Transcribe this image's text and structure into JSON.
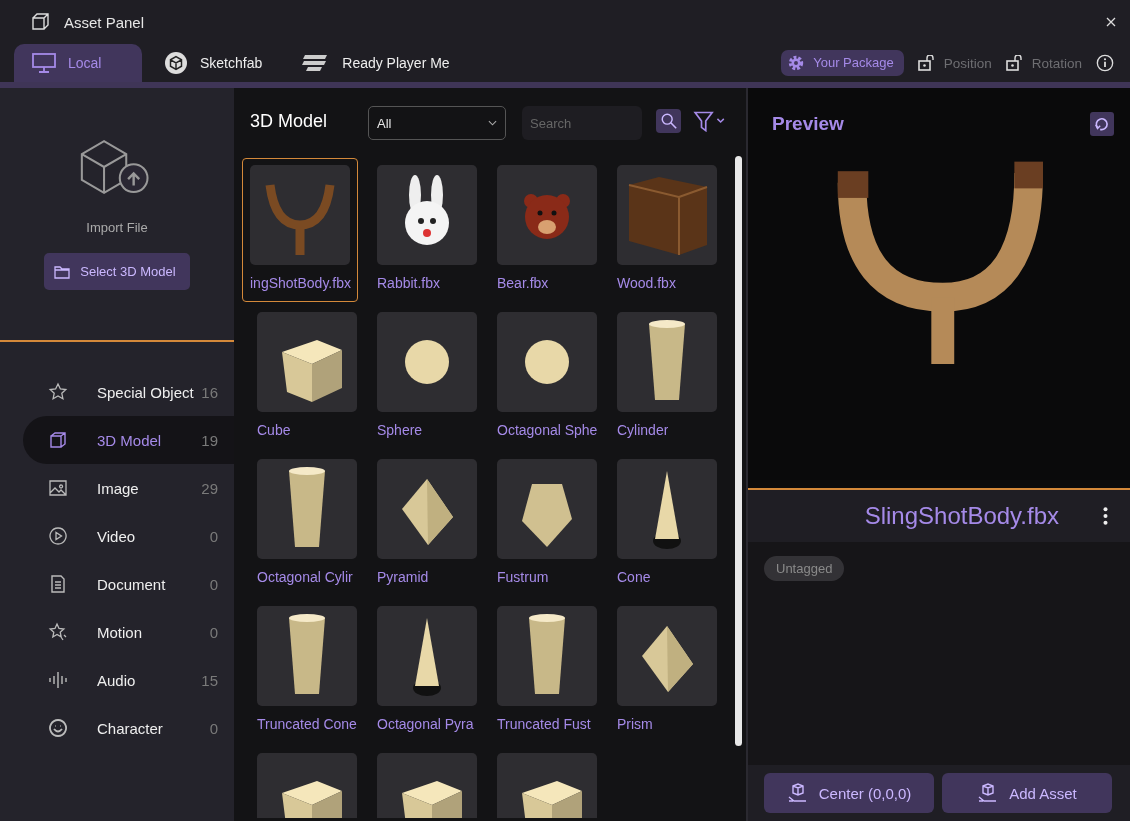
{
  "window": {
    "title": "Asset Panel"
  },
  "tabs": [
    {
      "label": "Local",
      "kind": "monitor",
      "selected": true
    },
    {
      "label": "Sketchfab",
      "kind": "sketchfab",
      "selected": false
    },
    {
      "label": "Ready Player Me",
      "kind": "rpm",
      "selected": false
    }
  ],
  "toolbar": {
    "package": "Your Package",
    "position": "Position",
    "rotation": "Rotation"
  },
  "import": {
    "label": "Import File",
    "button": "Select 3D Model"
  },
  "categories": [
    {
      "label": "Special Object",
      "count": "16",
      "kind": "star",
      "selected": false
    },
    {
      "label": "3D Model",
      "count": "19",
      "kind": "cube",
      "selected": true
    },
    {
      "label": "Image",
      "count": "29",
      "kind": "image",
      "selected": false
    },
    {
      "label": "Video",
      "count": "0",
      "kind": "video",
      "selected": false
    },
    {
      "label": "Document",
      "count": "0",
      "kind": "document",
      "selected": false
    },
    {
      "label": "Motion",
      "count": "0",
      "kind": "motion",
      "selected": false
    },
    {
      "label": "Audio",
      "count": "15",
      "kind": "audio",
      "selected": false
    },
    {
      "label": "Character",
      "count": "0",
      "kind": "character",
      "selected": false
    }
  ],
  "grid": {
    "title": "3D Model",
    "filter": "All",
    "search_placeholder": "Search",
    "items": [
      {
        "label": "ingShotBody.fbx",
        "kind": "slingshot",
        "selected": true
      },
      {
        "label": "Rabbit.fbx",
        "kind": "rabbit",
        "selected": false
      },
      {
        "label": "Bear.fbx",
        "kind": "bear",
        "selected": false
      },
      {
        "label": "Wood.fbx",
        "kind": "wood",
        "selected": false
      },
      {
        "label": "Cube",
        "kind": "cube",
        "selected": false
      },
      {
        "label": "Sphere",
        "kind": "sphere",
        "selected": false
      },
      {
        "label": "Octagonal Sphe",
        "kind": "sphere",
        "selected": false
      },
      {
        "label": "Cylinder",
        "kind": "cylinder",
        "selected": false
      },
      {
        "label": "Octagonal Cylir",
        "kind": "cylinder",
        "selected": false
      },
      {
        "label": "Pyramid",
        "kind": "pyramid",
        "selected": false
      },
      {
        "label": "Fustrum",
        "kind": "fustrum",
        "selected": false
      },
      {
        "label": "Cone",
        "kind": "cone",
        "selected": false
      },
      {
        "label": "Truncated Cone",
        "kind": "cylinder",
        "selected": false
      },
      {
        "label": "Octagonal Pyra",
        "kind": "cone",
        "selected": false
      },
      {
        "label": "Truncated Fust",
        "kind": "cylinder",
        "selected": false
      },
      {
        "label": "Prism",
        "kind": "pyramid",
        "selected": false
      },
      {
        "kind": "cube",
        "selected": false
      },
      {
        "kind": "cube",
        "selected": false
      },
      {
        "kind": "cube",
        "selected": false
      }
    ]
  },
  "preview": {
    "title": "Preview",
    "name": "SlingShotBody.fbx",
    "tag": "Untagged",
    "buttons": [
      "Center (0,0,0)",
      "Add Asset"
    ]
  }
}
